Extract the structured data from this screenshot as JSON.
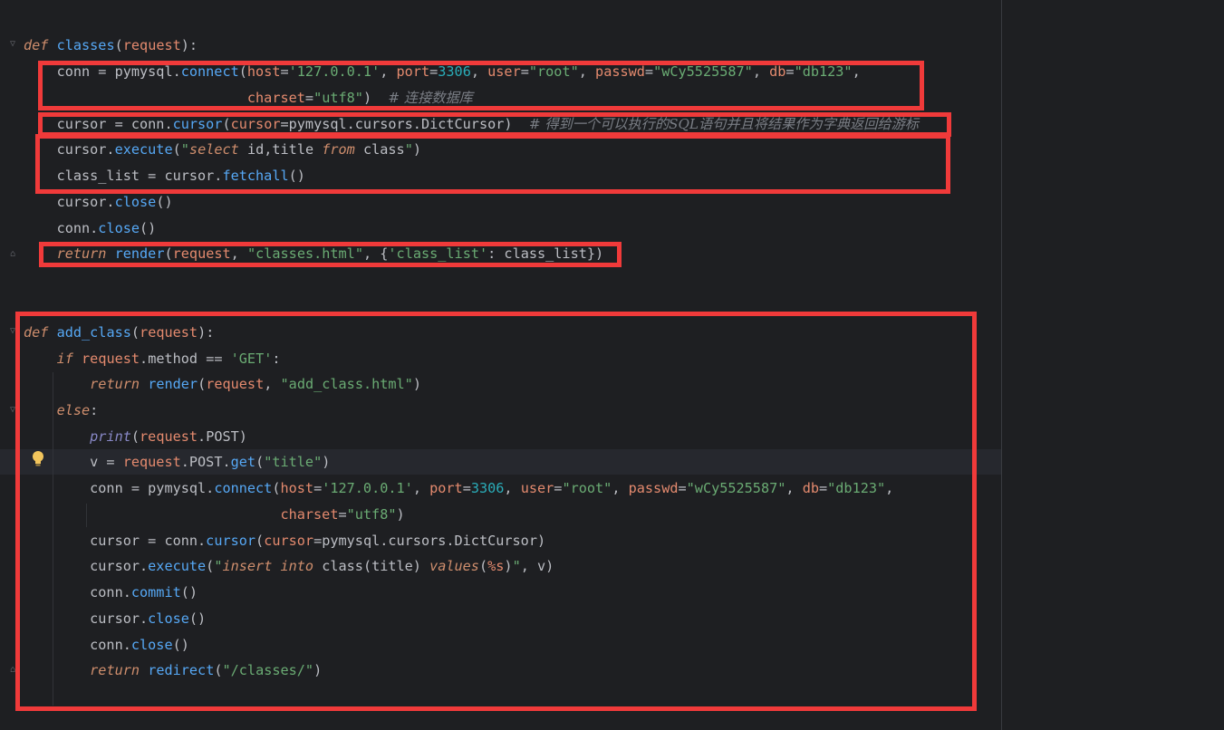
{
  "editor": {
    "language": "python",
    "lines": [
      {
        "id": "l1",
        "tokens": [
          [
            "def",
            "def"
          ],
          [
            "txt",
            " "
          ],
          [
            "fn",
            "classes"
          ],
          [
            "txt",
            "("
          ],
          [
            "prm",
            "request"
          ],
          [
            "txt",
            "):"
          ]
        ]
      },
      {
        "id": "l2",
        "tokens": [
          [
            "txt",
            "    conn = pymysql."
          ],
          [
            "mth",
            "connect"
          ],
          [
            "txt",
            "("
          ],
          [
            "prm",
            "host"
          ],
          [
            "txt",
            "="
          ],
          [
            "str",
            "'127.0.0.1'"
          ],
          [
            "txt",
            ", "
          ],
          [
            "prm",
            "port"
          ],
          [
            "txt",
            "="
          ],
          [
            "num",
            "3306"
          ],
          [
            "txt",
            ", "
          ],
          [
            "prm",
            "user"
          ],
          [
            "txt",
            "="
          ],
          [
            "str",
            "\"root\""
          ],
          [
            "txt",
            ", "
          ],
          [
            "prm",
            "passwd"
          ],
          [
            "txt",
            "="
          ],
          [
            "str",
            "\"wCy5525587\""
          ],
          [
            "txt",
            ", "
          ],
          [
            "prm",
            "db"
          ],
          [
            "txt",
            "="
          ],
          [
            "str",
            "\"db123\""
          ],
          [
            "txt",
            ","
          ]
        ]
      },
      {
        "id": "l3",
        "tokens": [
          [
            "txt",
            "                           "
          ],
          [
            "prm",
            "charset"
          ],
          [
            "txt",
            "="
          ],
          [
            "str",
            "\"utf8\""
          ],
          [
            "txt",
            ")  "
          ],
          [
            "cmt",
            "# 连接数据库"
          ]
        ]
      },
      {
        "id": "l4",
        "tokens": [
          [
            "txt",
            "    cursor = conn."
          ],
          [
            "mth",
            "cursor"
          ],
          [
            "txt",
            "("
          ],
          [
            "prm",
            "cursor"
          ],
          [
            "txt",
            "=pymysql.cursors.DictCursor)  "
          ],
          [
            "cmt",
            "# 得到一个可以执行的SQL语句并且将结果作为字典返回给游标"
          ]
        ]
      },
      {
        "id": "l5",
        "tokens": [
          [
            "txt",
            "    cursor."
          ],
          [
            "mth",
            "execute"
          ],
          [
            "txt",
            "("
          ],
          [
            "str",
            "\""
          ],
          [
            "sqlkw",
            "select"
          ],
          [
            "str",
            " "
          ],
          [
            "txt",
            "id,title "
          ],
          [
            "sqlkw",
            "from"
          ],
          [
            "txt",
            " class"
          ],
          [
            "str",
            "\""
          ],
          [
            "txt",
            ")"
          ]
        ]
      },
      {
        "id": "l6",
        "tokens": [
          [
            "txt",
            "    class_list = cursor."
          ],
          [
            "mth",
            "fetchall"
          ],
          [
            "txt",
            "()"
          ]
        ]
      },
      {
        "id": "l7",
        "tokens": [
          [
            "txt",
            "    cursor."
          ],
          [
            "mth",
            "close"
          ],
          [
            "txt",
            "()"
          ]
        ]
      },
      {
        "id": "l8",
        "tokens": [
          [
            "txt",
            "    conn."
          ],
          [
            "mth",
            "close"
          ],
          [
            "txt",
            "()"
          ]
        ]
      },
      {
        "id": "l9",
        "tokens": [
          [
            "txt",
            "    "
          ],
          [
            "kw",
            "return"
          ],
          [
            "txt",
            " "
          ],
          [
            "fn",
            "render"
          ],
          [
            "txt",
            "("
          ],
          [
            "prm",
            "request"
          ],
          [
            "txt",
            ", "
          ],
          [
            "str",
            "\"classes.html\""
          ],
          [
            "txt",
            ", {"
          ],
          [
            "str",
            "'class_list'"
          ],
          [
            "txt",
            ": class_list})"
          ]
        ]
      },
      {
        "id": "l10",
        "tokens": []
      },
      {
        "id": "l11",
        "tokens": []
      },
      {
        "id": "l12",
        "tokens": [
          [
            "def",
            "def"
          ],
          [
            "txt",
            " "
          ],
          [
            "fn",
            "add_class"
          ],
          [
            "txt",
            "("
          ],
          [
            "prm",
            "request"
          ],
          [
            "txt",
            "):"
          ]
        ]
      },
      {
        "id": "l13",
        "tokens": [
          [
            "txt",
            "    "
          ],
          [
            "kw",
            "if"
          ],
          [
            "txt",
            " "
          ],
          [
            "prm",
            "request"
          ],
          [
            "txt",
            ".method == "
          ],
          [
            "str",
            "'GET'"
          ],
          [
            "txt",
            ":"
          ]
        ]
      },
      {
        "id": "l14",
        "tokens": [
          [
            "txt",
            "        "
          ],
          [
            "kw",
            "return"
          ],
          [
            "txt",
            " "
          ],
          [
            "fn",
            "render"
          ],
          [
            "txt",
            "("
          ],
          [
            "prm",
            "request"
          ],
          [
            "txt",
            ", "
          ],
          [
            "str",
            "\"add_class.html\""
          ],
          [
            "txt",
            ")"
          ]
        ]
      },
      {
        "id": "l15",
        "tokens": [
          [
            "txt",
            "    "
          ],
          [
            "kw",
            "else"
          ],
          [
            "txt",
            ":"
          ]
        ]
      },
      {
        "id": "l16",
        "tokens": [
          [
            "txt",
            "        "
          ],
          [
            "bi",
            "print"
          ],
          [
            "txt",
            "("
          ],
          [
            "prm",
            "request"
          ],
          [
            "txt",
            ".POST)"
          ]
        ]
      },
      {
        "id": "l17",
        "tokens": [
          [
            "txt",
            "        v = "
          ],
          [
            "prm",
            "request"
          ],
          [
            "txt",
            ".POST."
          ],
          [
            "mth",
            "get"
          ],
          [
            "txt",
            "("
          ],
          [
            "str",
            "\"title\""
          ],
          [
            "txt",
            ")"
          ]
        ]
      },
      {
        "id": "l18",
        "tokens": [
          [
            "txt",
            "        conn = pymysql."
          ],
          [
            "mth",
            "connect"
          ],
          [
            "txt",
            "("
          ],
          [
            "prm",
            "host"
          ],
          [
            "txt",
            "="
          ],
          [
            "str",
            "'127.0.0.1'"
          ],
          [
            "txt",
            ", "
          ],
          [
            "prm",
            "port"
          ],
          [
            "txt",
            "="
          ],
          [
            "num",
            "3306"
          ],
          [
            "txt",
            ", "
          ],
          [
            "prm",
            "user"
          ],
          [
            "txt",
            "="
          ],
          [
            "str",
            "\"root\""
          ],
          [
            "txt",
            ", "
          ],
          [
            "prm",
            "passwd"
          ],
          [
            "txt",
            "="
          ],
          [
            "str",
            "\"wCy5525587\""
          ],
          [
            "txt",
            ", "
          ],
          [
            "prm",
            "db"
          ],
          [
            "txt",
            "="
          ],
          [
            "str",
            "\"db123\""
          ],
          [
            "txt",
            ","
          ]
        ]
      },
      {
        "id": "l19",
        "tokens": [
          [
            "txt",
            "                               "
          ],
          [
            "prm",
            "charset"
          ],
          [
            "txt",
            "="
          ],
          [
            "str",
            "\"utf8\""
          ],
          [
            "txt",
            ")"
          ]
        ]
      },
      {
        "id": "l20",
        "tokens": [
          [
            "txt",
            "        cursor = conn."
          ],
          [
            "mth",
            "cursor"
          ],
          [
            "txt",
            "("
          ],
          [
            "prm",
            "cursor"
          ],
          [
            "txt",
            "=pymysql.cursors.DictCursor)"
          ]
        ]
      },
      {
        "id": "l21",
        "tokens": [
          [
            "txt",
            "        cursor."
          ],
          [
            "mth",
            "execute"
          ],
          [
            "txt",
            "("
          ],
          [
            "str",
            "\""
          ],
          [
            "sqlkw",
            "insert into"
          ],
          [
            "txt",
            " class(title) "
          ],
          [
            "sqlkw",
            "values"
          ],
          [
            "txt",
            "("
          ],
          [
            "prm",
            "%s"
          ],
          [
            "txt",
            ")"
          ],
          [
            "str",
            "\""
          ],
          [
            "txt",
            ", v)"
          ]
        ]
      },
      {
        "id": "l22",
        "tokens": [
          [
            "txt",
            "        conn."
          ],
          [
            "mth",
            "commit"
          ],
          [
            "txt",
            "()"
          ]
        ]
      },
      {
        "id": "l23",
        "tokens": [
          [
            "txt",
            "        cursor."
          ],
          [
            "mth",
            "close"
          ],
          [
            "txt",
            "()"
          ]
        ]
      },
      {
        "id": "l24",
        "tokens": [
          [
            "txt",
            "        conn."
          ],
          [
            "mth",
            "close"
          ],
          [
            "txt",
            "()"
          ]
        ]
      },
      {
        "id": "l25",
        "tokens": [
          [
            "txt",
            "        "
          ],
          [
            "kw",
            "return"
          ],
          [
            "txt",
            " "
          ],
          [
            "fn",
            "redirect"
          ],
          [
            "txt",
            "("
          ],
          [
            "str",
            "\"/classes/\""
          ],
          [
            "txt",
            ")"
          ]
        ]
      }
    ]
  },
  "icons": {
    "fold": "fold-arrow-icon",
    "intention": "lightbulb-icon"
  },
  "colors": {
    "background": "#1e1f22",
    "annotation_box": "#f03a3a"
  }
}
